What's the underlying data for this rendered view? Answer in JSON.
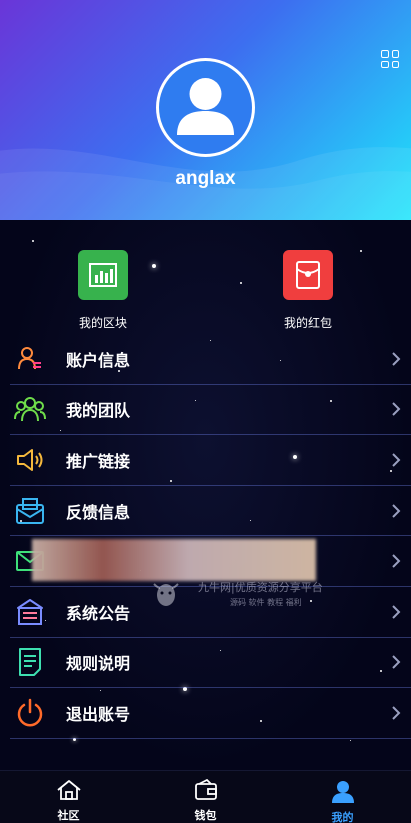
{
  "profile": {
    "username": "anglax"
  },
  "quick_actions": [
    {
      "label": "我的区块",
      "icon": "bar-chart-icon",
      "color": "#37b24d"
    },
    {
      "label": "我的红包",
      "icon": "red-envelope-icon",
      "color": "#f03e3e"
    }
  ],
  "menu": [
    {
      "label": "账户信息",
      "icon": "account-icon"
    },
    {
      "label": "我的团队",
      "icon": "team-icon"
    },
    {
      "label": "推广链接",
      "icon": "speaker-icon"
    },
    {
      "label": "反馈信息",
      "icon": "mail-icon"
    },
    {
      "label": "",
      "icon": "envelope-icon"
    },
    {
      "label": "系统公告",
      "icon": "notice-icon"
    },
    {
      "label": "规则说明",
      "icon": "document-icon"
    },
    {
      "label": "退出账号",
      "icon": "power-icon"
    }
  ],
  "watermark": {
    "title": "九牛网|优质资源分享平台",
    "subtitle": "源码 软件 教程 福利"
  },
  "tabbar": [
    {
      "label": "社区",
      "icon": "home-icon",
      "active": false
    },
    {
      "label": "钱包",
      "icon": "wallet-icon",
      "active": false
    },
    {
      "label": "我的",
      "icon": "user-icon",
      "active": true
    }
  ],
  "colors": {
    "header_start": "#6a35d8",
    "header_end": "#1ee6fb",
    "active_tab": "#3aa0ff"
  }
}
